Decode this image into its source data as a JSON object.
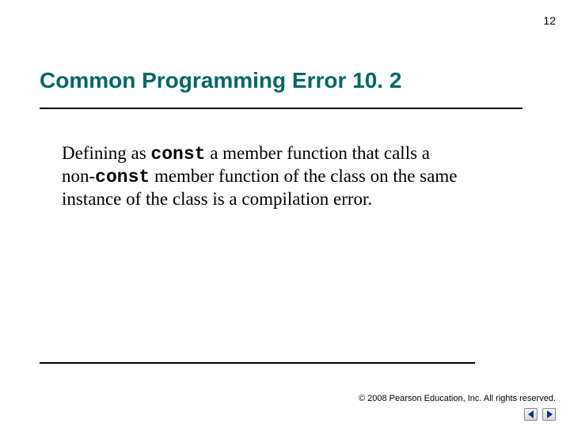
{
  "page_number": "12",
  "heading": "Common Programming Error 10. 2",
  "body": {
    "part1": "Defining as ",
    "const1": "const",
    "part2": " a member function that calls a non-",
    "const2": "const",
    "part3": " member function of the class on the same instance of the class is a compilation error."
  },
  "copyright": "© 2008 Pearson Education, Inc.  All rights reserved.",
  "nav": {
    "prev_label": "Previous",
    "next_label": "Next"
  },
  "colors": {
    "heading": "#006666",
    "nav_arrow": "#003399"
  }
}
